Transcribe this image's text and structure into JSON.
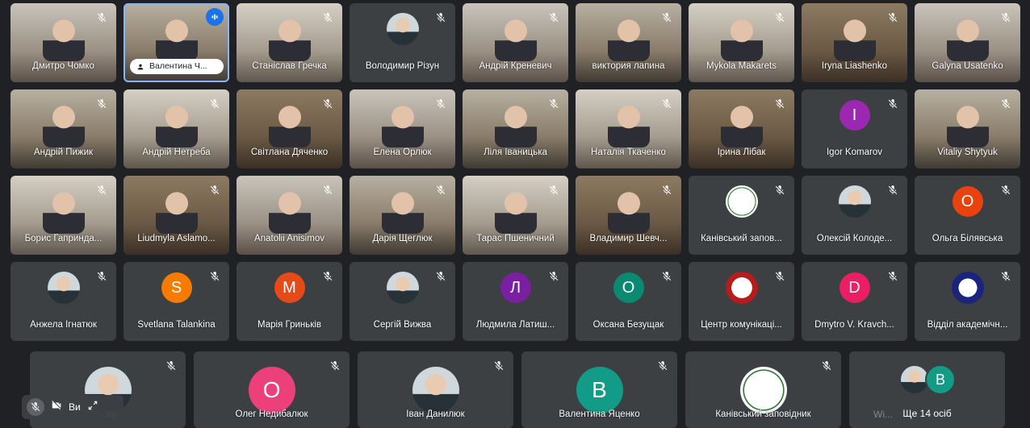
{
  "colors": {
    "background": "#202124",
    "tile": "#3c4043",
    "speaking": "#1e8e3e",
    "active_mic": "#1a73e8",
    "selected_border": "#8ab4f8"
  },
  "tiles": [
    {
      "name": "Дмитро Чомко",
      "kind": "video"
    },
    {
      "name": "Валентина Ч...",
      "kind": "video",
      "pill": true,
      "speaking": true
    },
    {
      "name": "Станіслав Гречка",
      "kind": "video"
    },
    {
      "name": "Володимир Різун",
      "kind": "photo"
    },
    {
      "name": "Андрій Креневич",
      "kind": "video"
    },
    {
      "name": "виктория лапина",
      "kind": "video"
    },
    {
      "name": "Mykola Makarets",
      "kind": "video"
    },
    {
      "name": "Iryna Liashenko",
      "kind": "video"
    },
    {
      "name": "Galyna Usatenko",
      "kind": "video"
    },
    {
      "name": "Андрій Пижик",
      "kind": "video"
    },
    {
      "name": "Андрій Нетреба",
      "kind": "video"
    },
    {
      "name": "Світлана Дяченко",
      "kind": "video"
    },
    {
      "name": "Елена Орлюк",
      "kind": "video"
    },
    {
      "name": "Ліля Іваницька",
      "kind": "video"
    },
    {
      "name": "Наталія Ткаченко",
      "kind": "video"
    },
    {
      "name": "Ірина Лібак",
      "kind": "video"
    },
    {
      "name": "Igor Komarov",
      "kind": "letter",
      "letter": "I",
      "color": "#9c27b0"
    },
    {
      "name": "Vitaliy Shytyuk",
      "kind": "video"
    },
    {
      "name": "Борис Гапринда...",
      "kind": "video"
    },
    {
      "name": "Liudmyla Aslamo...",
      "kind": "video"
    },
    {
      "name": "Anatolii Anisimov",
      "kind": "video"
    },
    {
      "name": "Дарія Щеглюк",
      "kind": "video"
    },
    {
      "name": "Тарас Пшеничний",
      "kind": "video"
    },
    {
      "name": "Владимир Шевч...",
      "kind": "video"
    },
    {
      "name": "Канівський запов...",
      "kind": "logo"
    },
    {
      "name": "Олексій Колоде...",
      "kind": "photo"
    },
    {
      "name": "Ольга Білявська",
      "kind": "letter",
      "letter": "О",
      "color": "#e8430e"
    },
    {
      "name": "Анжела Ігнатюк",
      "kind": "photo"
    },
    {
      "name": "Svetlana Talankina",
      "kind": "letter",
      "letter": "S",
      "color": "#f57c00"
    },
    {
      "name": "Марія Гриньків",
      "kind": "letter",
      "letter": "М",
      "color": "#e64a19"
    },
    {
      "name": "Сергій Вижва",
      "kind": "photo"
    },
    {
      "name": "Людмила Латиш...",
      "kind": "letter",
      "letter": "Л",
      "color": "#7b1fa2"
    },
    {
      "name": "Оксана Безущак",
      "kind": "letter",
      "letter": "О",
      "color": "#0b8a72"
    },
    {
      "name": "Центр комунікаці...",
      "kind": "logo-red"
    },
    {
      "name": "Dmytro V. Kravch...",
      "kind": "letter",
      "letter": "D",
      "color": "#e91e63"
    },
    {
      "name": "Відділ академічн...",
      "kind": "logo-blue"
    }
  ],
  "bottom_row": [
    {
      "name": "...ва",
      "kind": "photo"
    },
    {
      "name": "Олег Недибалюк",
      "kind": "letter",
      "letter": "О",
      "color": "#ec407a"
    },
    {
      "name": "Іван Данилюк",
      "kind": "photo"
    },
    {
      "name": "Валентина Яценко",
      "kind": "letter",
      "letter": "В",
      "color": "#129b87"
    },
    {
      "name": "Канівський заповідник",
      "kind": "logo"
    },
    {
      "name": "Ще 14 осіб",
      "kind": "more",
      "letter": "B"
    }
  ],
  "self_controls": {
    "you_label": "Ви"
  },
  "watermark": "Wi..."
}
